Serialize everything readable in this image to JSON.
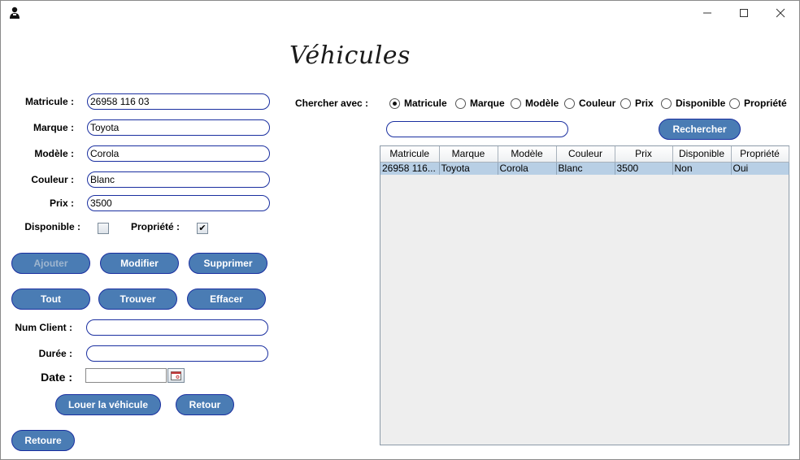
{
  "window": {
    "minimize_icon": "minimize-icon",
    "maximize_icon": "maximize-icon",
    "close_icon": "close-icon",
    "app_icon": "user-icon"
  },
  "page_title": "Véhicules",
  "form": {
    "matricule_label": "Matricule :",
    "matricule_value": "26958 116 03",
    "marque_label": "Marque :",
    "marque_value": "Toyota",
    "modele_label": "Modèle :",
    "modele_value": "Corola",
    "couleur_label": "Couleur :",
    "couleur_value": "Blanc",
    "prix_label": "Prix :",
    "prix_value": "3500",
    "disponible_label": "Disponible :",
    "disponible_checked": false,
    "propriete_label": "Propriété :",
    "propriete_checked": true
  },
  "buttons": {
    "ajouter": "Ajouter",
    "modifier": "Modifier",
    "supprimer": "Supprimer",
    "tout": "Tout",
    "trouver": "Trouver",
    "effacer": "Effacer",
    "louer": "Louer la véhicule",
    "retour": "Retour",
    "retoure": "Retoure",
    "rechercher": "Rechercher"
  },
  "rental": {
    "num_client_label": "Num Client :",
    "num_client_value": "",
    "duree_label": "Durée :",
    "duree_value": "",
    "date_label": "Date :",
    "date_value": ""
  },
  "search": {
    "label": "Chercher avec :",
    "options": [
      "Matricule",
      "Marque",
      "Modèle",
      "Couleur",
      "Prix",
      "Disponible",
      "Propriété"
    ],
    "selected": "Matricule",
    "query": ""
  },
  "table": {
    "columns": [
      "Matricule",
      "Marque",
      "Modèle",
      "Couleur",
      "Prix",
      "Disponible",
      "Propriété"
    ],
    "rows": [
      [
        "26958 116...",
        "Toyota",
        "Corola",
        "Blanc",
        "3500",
        "Non",
        "Oui"
      ]
    ]
  },
  "colors": {
    "button_bg": "#4a7cb4",
    "field_border": "#1a2fa0",
    "row_selected": "#b8cfe5"
  }
}
